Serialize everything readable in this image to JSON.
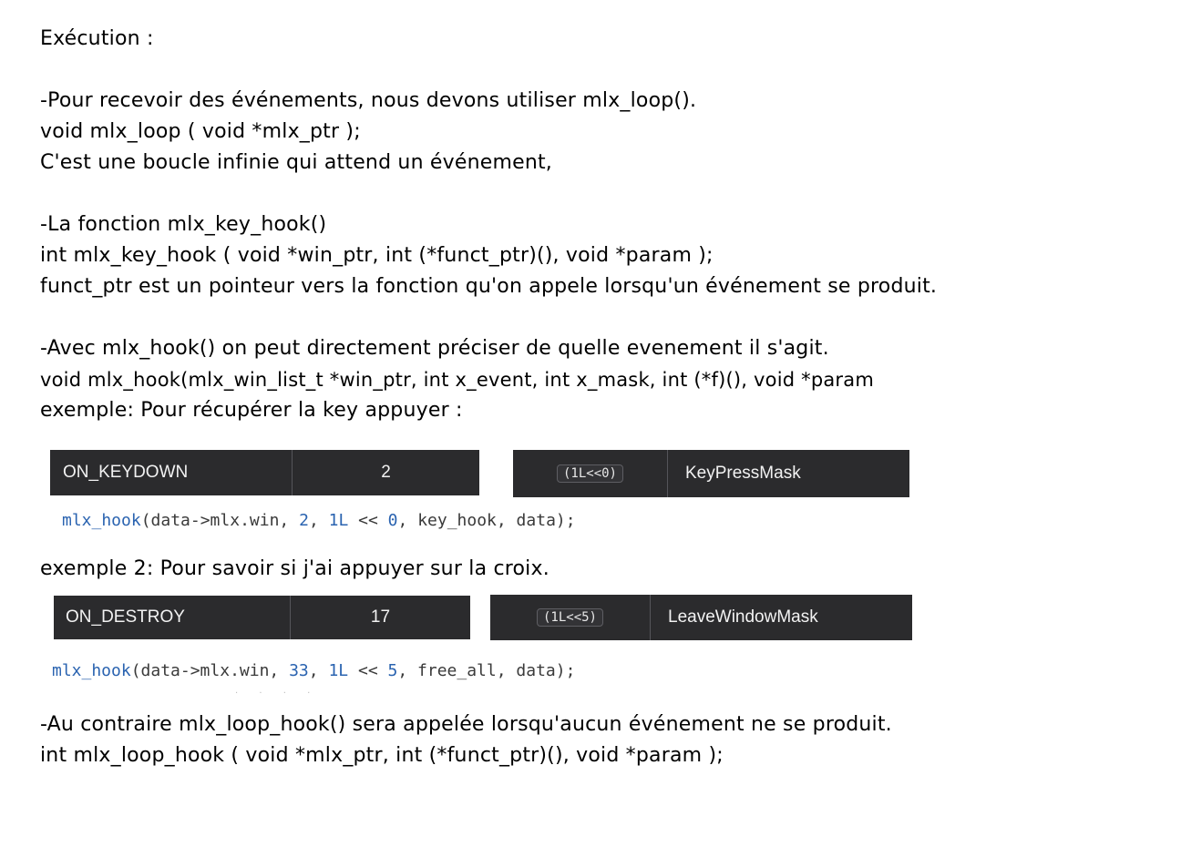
{
  "title": "Exécution :",
  "section1": [
    "-Pour recevoir des événements, nous devons utiliser mlx_loop().",
    "void mlx_loop ( void *mlx_ptr );",
    "C'est une boucle infinie qui attend un événement,"
  ],
  "section2": [
    "-La fonction mlx_key_hook()",
    "int mlx_key_hook ( void *win_ptr, int (*funct_ptr)(), void *param );",
    "funct_ptr est un pointeur vers la fonction qu'on appele lorsqu'un événement se produit."
  ],
  "section3": [
    "-Avec mlx_hook() on peut directement préciser de quelle evenement il s'agit.",
    "void mlx_hook(mlx_win_list_t *win_ptr, int x_event, int x_mask, int (*f)(), void *param",
    "exemple: Pour récupérer la key appuyer :"
  ],
  "example1": {
    "event_name": "ON_KEYDOWN",
    "event_code": "2",
    "mask_value": "(1L<<0)",
    "mask_name": "KeyPressMask",
    "code": {
      "fn": "mlx_hook",
      "p1": "(data->mlx.win, ",
      "n1": "2",
      "p2": ", ",
      "n2": "1L",
      "p3": " << ",
      "n3": "0",
      "p4": ", key_hook, data);"
    }
  },
  "example2_heading": "exemple 2: Pour savoir si j'ai appuyer sur la croix.",
  "example2": {
    "event_name": "ON_DESTROY",
    "event_code": "17",
    "mask_value": "(1L<<5)",
    "mask_name": "LeaveWindowMask",
    "code": {
      "fn": "mlx_hook",
      "p1": "(data->mlx.win, ",
      "n1": "33",
      "p2": ", ",
      "n2": "1L",
      "p3": " << ",
      "n3": "5",
      "p4": ", free_all, data);"
    }
  },
  "section4": [
    "-Au contraire mlx_loop_hook() sera appelée lorsqu'aucun événement ne se produit.",
    "int mlx_loop_hook ( void *mlx_ptr, int (*funct_ptr)(), void *param );"
  ],
  "colors": {
    "table_bg": "#2b2b2d",
    "code_function": "#2a63b0",
    "code_text": "#3a3a3a"
  }
}
